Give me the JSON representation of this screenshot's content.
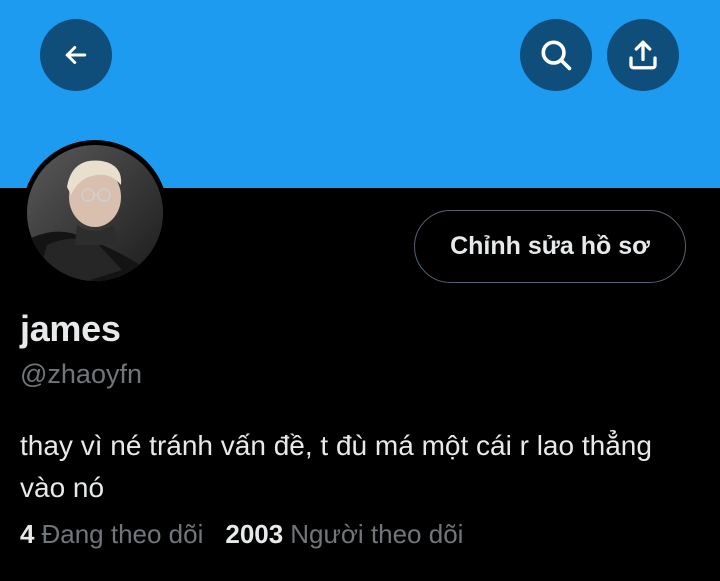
{
  "header": {
    "banner_color": "#1d9bf0",
    "back_icon": "arrow-left-icon",
    "search_icon": "search-icon",
    "share_icon": "share-upload-icon"
  },
  "profile": {
    "avatar": "profile-photo",
    "edit_button_label": "Chỉnh sửa hồ sơ",
    "display_name": "james",
    "handle": "@zhaoyfn",
    "bio": "thay vì né tránh vấn đề, t đù má một cái r lao thẳng vào nó"
  },
  "stats": {
    "following_count": "4",
    "following_label": "Đang theo dõi",
    "followers_count": "2003",
    "followers_label": "Người theo dõi"
  },
  "colors": {
    "background": "#000000",
    "text_primary": "#e7e9ea",
    "text_secondary": "#71767b",
    "button_overlay": "#0f4d7a"
  }
}
